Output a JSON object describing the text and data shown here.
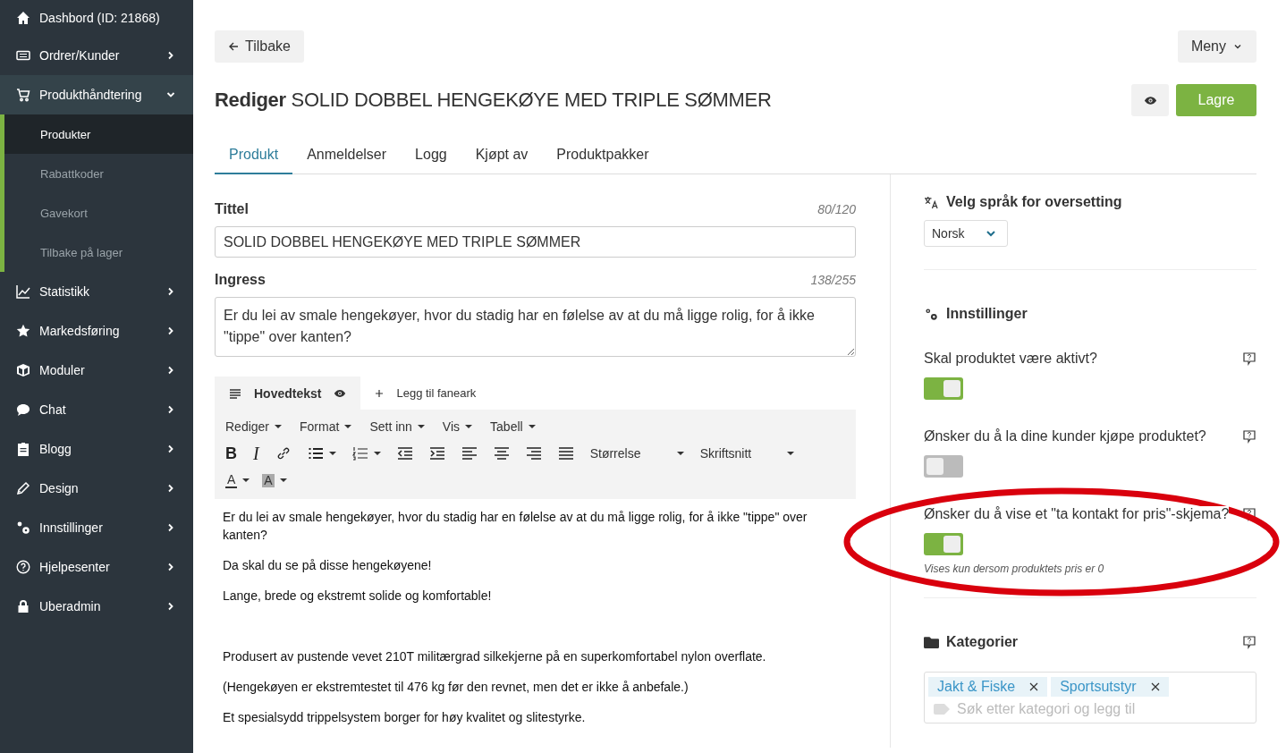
{
  "sidebar": {
    "items": [
      {
        "label": "Dashbord (ID: 21868)"
      },
      {
        "label": "Ordrer/Kunder",
        "expanded": false
      },
      {
        "label": "Produkthåndtering",
        "expanded": true,
        "children": [
          {
            "label": "Produkter",
            "selected": true
          },
          {
            "label": "Rabattkoder",
            "selected": false
          },
          {
            "label": "Gavekort",
            "selected": false
          },
          {
            "label": "Tilbake på lager",
            "selected": false
          }
        ]
      },
      {
        "label": "Statistikk",
        "expanded": false
      },
      {
        "label": "Markedsføring",
        "expanded": false
      },
      {
        "label": "Moduler",
        "expanded": false
      },
      {
        "label": "Chat",
        "expanded": false
      },
      {
        "label": "Blogg",
        "expanded": false
      },
      {
        "label": "Design",
        "expanded": false
      },
      {
        "label": "Innstillinger",
        "expanded": false
      },
      {
        "label": "Hjelpesenter",
        "expanded": false
      },
      {
        "label": "Uberadmin",
        "expanded": false
      }
    ]
  },
  "header": {
    "back": "Tilbake",
    "menu": "Meny",
    "title_prefix": "Rediger",
    "title": "SOLID DOBBEL HENGEKØYE MED TRIPLE SØMMER",
    "save": "Lagre"
  },
  "tabs": [
    {
      "label": "Produkt",
      "selected": true
    },
    {
      "label": "Anmeldelser",
      "selected": false
    },
    {
      "label": "Logg",
      "selected": false
    },
    {
      "label": "Kjøpt av",
      "selected": false
    },
    {
      "label": "Produktpakker",
      "selected": false
    }
  ],
  "fields": [
    {
      "kind": "input",
      "label": "Tittel",
      "count": "80/120",
      "value": "SOLID DOBBEL HENGEKØYE MED TRIPLE SØMMER"
    },
    {
      "kind": "textarea",
      "label": "Ingress",
      "count": "138/255",
      "value": "Er du lei av smale hengekøyer, hvor du stadig har en følelse av at du må ligge rolig, for å ikke \"tippe\" over kanten?"
    }
  ],
  "editor": {
    "tabs": [
      {
        "label": "Hovedtekst",
        "selected": true
      },
      {
        "label": "Legg til faneark",
        "selected": false
      }
    ],
    "menus": [
      "Rediger",
      "Format",
      "Sett inn",
      "Vis",
      "Tabell"
    ],
    "buttons": [
      {
        "kind": "bold",
        "text": "B"
      },
      {
        "kind": "italic",
        "text": "I"
      },
      {
        "kind": "link"
      },
      {
        "kind": "bullets",
        "dropdown": true
      },
      {
        "kind": "numbers",
        "dropdown": true
      },
      {
        "kind": "outdent"
      },
      {
        "kind": "indent"
      },
      {
        "kind": "align-left"
      },
      {
        "kind": "align-center"
      },
      {
        "kind": "align-right"
      },
      {
        "kind": "justify"
      }
    ],
    "selects": [
      "Størrelse",
      "Skriftsnitt"
    ],
    "colors": [
      {
        "kind": "text-color",
        "text": "A"
      },
      {
        "kind": "background-color",
        "text": "A"
      }
    ],
    "paragraphs": [
      {
        "text": "Er du lei av smale hengekøyer, hvor du stadig har en følelse av at du må ligge rolig, for å ikke \"tippe\" over kanten?"
      },
      {
        "text": "Da skal du se på disse hengekøyene!"
      },
      {
        "text": "Lange, brede og ekstremt solide og komfortable!"
      },
      {
        "text": "Produsert av pustende vevet 210T militærgrad silkekjerne på en superkomfortabel nylon overflate.",
        "blank_before": true
      },
      {
        "text": "(Hengekøyen er ekstremtestet til 476 kg før den revnet, men det er ikke å anbefale.)"
      },
      {
        "text": "Et spesialsydd trippelsystem borger for høy kvalitet og slitestyrke."
      }
    ]
  },
  "language": {
    "heading": "Velg språk for oversetting",
    "value": "Norsk"
  },
  "settings": {
    "heading": "Innstillinger",
    "items": [
      {
        "label": "Skal produktet være aktivt?",
        "on": true
      },
      {
        "label": "Ønsker du å la dine kunder kjøpe produktet?",
        "on": false
      },
      {
        "label": "Ønsker du å vise et \"ta kontakt for pris\"-skjema?",
        "on": true,
        "note": "Vises kun dersom produktets pris er 0"
      }
    ]
  },
  "categories": {
    "heading": "Kategorier",
    "tags": [
      "Jakt & Fiske",
      "Sportsutstyr"
    ],
    "placeholder": "Søk etter kategori og legg til"
  }
}
